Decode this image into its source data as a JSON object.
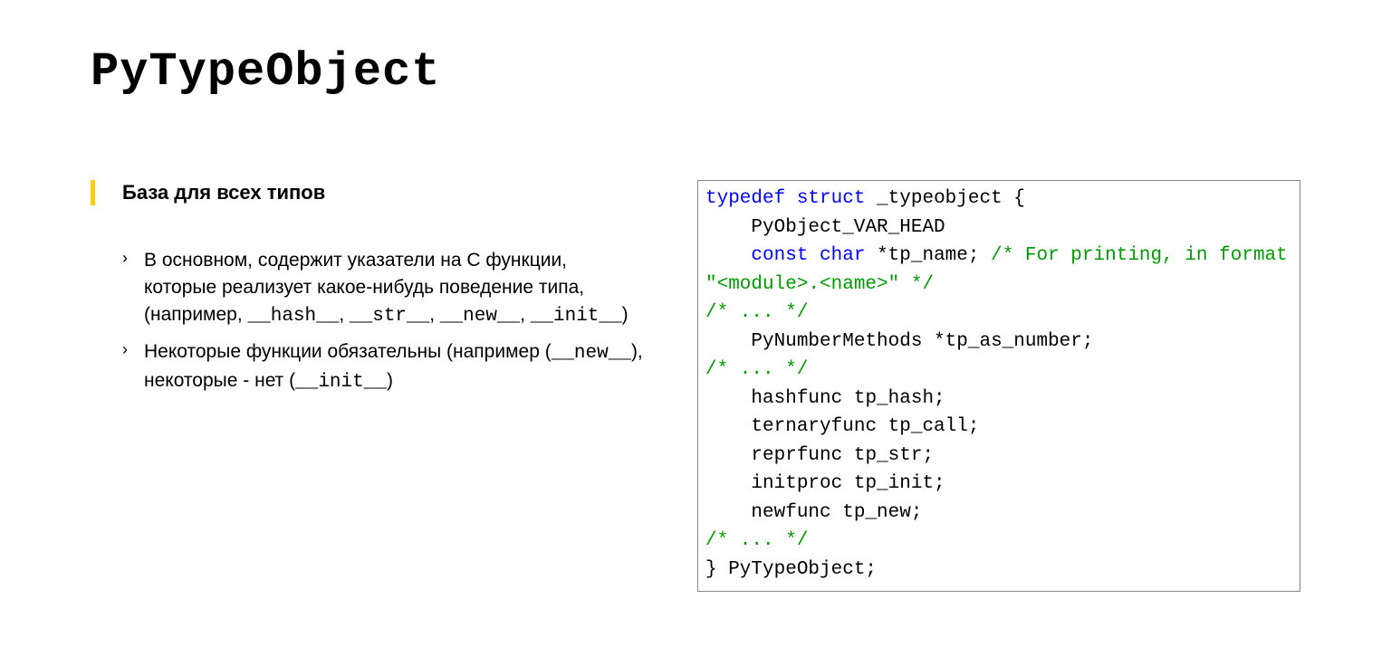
{
  "title": "PyTypeObject",
  "heading": "База для всех типов",
  "bullet1": {
    "t1": "В основном, содержит указатели на C функции, которые реализует какое-нибудь поведение типа, (например, ",
    "h": "__hash__",
    "c1": ", ",
    "s": "__str__",
    "c2": ", ",
    "n": "__new__",
    "c3": ", ",
    "i": "__init__",
    "t2": ")"
  },
  "bullet2": {
    "t1": "Некоторые функции обязательны (например (",
    "n": "__new__",
    "t2": "), некоторые - нет (",
    "i": "__init__",
    "t3": ")"
  },
  "code": {
    "l1a": "typedef",
    "l1b": "struct",
    "l1c": " _typeobject {",
    "l2": "    PyObject_VAR_HEAD",
    "l3a": "    ",
    "l3b": "const",
    "l3c": " ",
    "l3d": "char",
    "l3e": " *tp_name; ",
    "l3f": "/* For printing, in format \"<module>.<name>\" */",
    "l4": "/* ... */",
    "l5": "    PyNumberMethods *tp_as_number;",
    "l6": "/* ... */",
    "l7": "    hashfunc tp_hash;",
    "l8": "    ternaryfunc tp_call;",
    "l9": "    reprfunc tp_str;",
    "l10": "    initproc tp_init;",
    "l11": "    newfunc tp_new;",
    "l12": "/* ... */",
    "l13": "} PyTypeObject;"
  }
}
